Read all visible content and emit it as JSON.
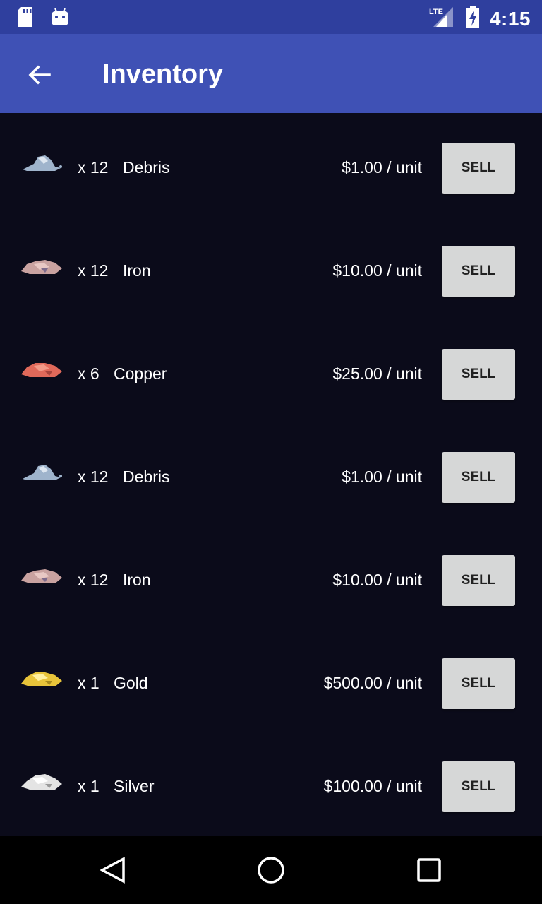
{
  "status_bar": {
    "time": "4:15",
    "network": "LTE",
    "icons": [
      "sd-card-icon",
      "android-icon",
      "lte-signal-icon",
      "battery-charging-icon"
    ]
  },
  "app_bar": {
    "title": "Inventory",
    "back_icon": "arrow-left-icon"
  },
  "inventory": {
    "sell_label": "SELL",
    "items": [
      {
        "qty": "x 12",
        "name": "Debris",
        "price": "$1.00 / unit",
        "color": "#9fb4cc"
      },
      {
        "qty": "x 12",
        "name": "Iron",
        "price": "$10.00 / unit",
        "color": "#c9a2a0"
      },
      {
        "qty": "x 6",
        "name": "Copper",
        "price": "$25.00 / unit",
        "color": "#e0695a"
      },
      {
        "qty": "x 12",
        "name": "Debris",
        "price": "$1.00 / unit",
        "color": "#9fb4cc"
      },
      {
        "qty": "x 12",
        "name": "Iron",
        "price": "$10.00 / unit",
        "color": "#c9a2a0"
      },
      {
        "qty": "x 1",
        "name": "Gold",
        "price": "$500.00 / unit",
        "color": "#e8c43a"
      },
      {
        "qty": "x 1",
        "name": "Silver",
        "price": "$100.00 / unit",
        "color": "#e4e4e4"
      }
    ]
  },
  "nav_bar": {
    "icons": [
      "back-triangle-icon",
      "home-circle-icon",
      "recents-square-icon"
    ]
  }
}
